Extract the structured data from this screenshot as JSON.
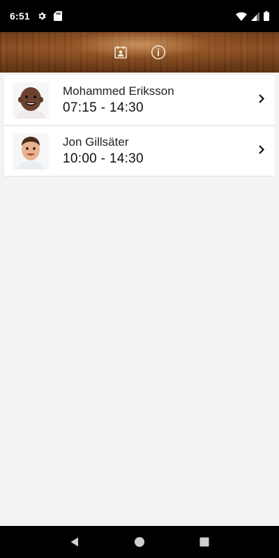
{
  "status_bar": {
    "time": "6:51",
    "icons": [
      "gear-icon",
      "sd-card-icon",
      "wifi-icon",
      "signal-icon",
      "battery-icon"
    ]
  },
  "header": {
    "buttons": [
      "calendar-contact-icon",
      "info-icon"
    ]
  },
  "children": [
    {
      "name": "Mohammed Eriksson",
      "time": "07:15 - 14:30"
    },
    {
      "name": "Jon Gillsäter",
      "time": "10:00 - 14:30"
    }
  ],
  "nav_bar": {
    "buttons": [
      "back-icon",
      "home-icon",
      "recents-icon"
    ]
  },
  "colors": {
    "status_bar": "#000000",
    "background": "#f3f3f3",
    "card": "#ffffff",
    "wood_dark": "#5a2e10",
    "wood_light": "#8a4c20"
  }
}
